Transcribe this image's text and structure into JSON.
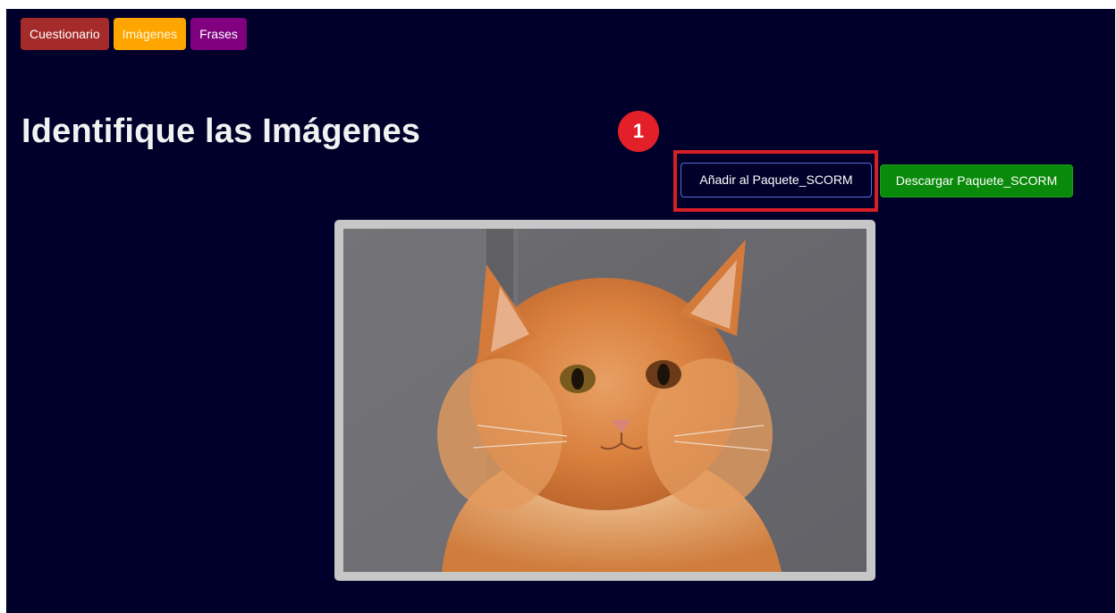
{
  "tabs": [
    {
      "label": "Cuestionario",
      "color": "#a52a2a"
    },
    {
      "label": "Imágenes",
      "color": "#ffa500"
    },
    {
      "label": "Frases",
      "color": "#800080"
    }
  ],
  "page": {
    "title": "Identifique las Imágenes",
    "background": "#00002a"
  },
  "annotation": {
    "step_number": "1",
    "color": "#e3202a"
  },
  "actions": {
    "add_label": "Añadir al Paquete_SCORM",
    "download_label": "Descargar Paquete_SCORM",
    "download_color": "#0a8a0a"
  },
  "image": {
    "subject": "orange-cat-photo"
  }
}
